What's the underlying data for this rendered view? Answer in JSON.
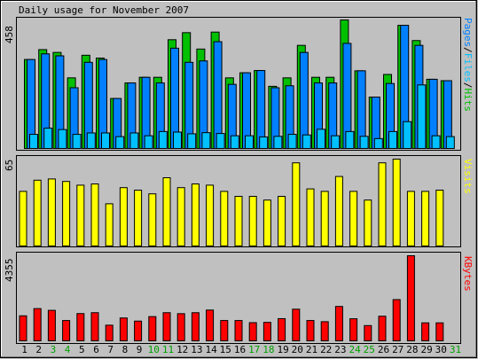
{
  "chart_data": [
    {
      "type": "bar",
      "title": "Daily usage for November 2007",
      "panel": "pages-files-hits",
      "ymax_label": "458",
      "legend": [
        {
          "label": "Pages",
          "color": "#0080ff"
        },
        {
          "label": "Files",
          "color": "#00c0ff"
        },
        {
          "label": "Hits",
          "color": "#00c000"
        }
      ],
      "legend_sep": "/",
      "categories": [
        "1",
        "2",
        "3",
        "4",
        "5",
        "6",
        "7",
        "8",
        "9",
        "10",
        "11",
        "12",
        "13",
        "14",
        "15",
        "16",
        "17",
        "18",
        "19",
        "20",
        "21",
        "22",
        "23",
        "24",
        "25",
        "26",
        "27",
        "28",
        "29",
        "30",
        "31"
      ],
      "series": [
        {
          "name": "Hits",
          "color": "#00c000",
          "values": [
            315,
            350,
            340,
            250,
            330,
            320,
            177,
            232,
            252,
            252,
            385,
            410,
            352,
            412,
            250,
            268,
            276,
            220,
            250,
            365,
            252,
            252,
            455,
            275,
            182,
            262,
            436,
            382,
            245,
            240,
            0
          ]
        },
        {
          "name": "Pages",
          "color": "#0080ff",
          "values": [
            315,
            335,
            328,
            215,
            305,
            315,
            177,
            232,
            252,
            232,
            355,
            305,
            310,
            378,
            227,
            268,
            276,
            215,
            222,
            340,
            232,
            232,
            372,
            275,
            182,
            230,
            436,
            365,
            245,
            240,
            0
          ]
        },
        {
          "name": "Files",
          "color": "#00c0ff",
          "values": [
            50,
            72,
            67,
            50,
            55,
            55,
            42,
            55,
            45,
            60,
            58,
            52,
            56,
            53,
            45,
            45,
            41,
            43,
            50,
            48,
            68,
            45,
            60,
            43,
            35,
            60,
            95,
            225,
            45,
            42,
            0
          ]
        }
      ]
    },
    {
      "type": "bar",
      "panel": "visits",
      "ymax_label": "65",
      "legend": [
        {
          "label": "Visits",
          "color": "#ffff00"
        }
      ],
      "categories": [
        "1",
        "2",
        "3",
        "4",
        "5",
        "6",
        "7",
        "8",
        "9",
        "10",
        "11",
        "12",
        "13",
        "14",
        "15",
        "16",
        "17",
        "18",
        "19",
        "20",
        "21",
        "22",
        "23",
        "24",
        "25",
        "26",
        "27",
        "28",
        "29",
        "30",
        "31"
      ],
      "series": [
        {
          "name": "Visits",
          "color": "#ffff00",
          "values": [
            44,
            53,
            54,
            52,
            49,
            50,
            34,
            47,
            45,
            42,
            55,
            47,
            50,
            49,
            44,
            40,
            40,
            37,
            40,
            67,
            46,
            44,
            56,
            44,
            37,
            67,
            70,
            44,
            44,
            45,
            0
          ]
        }
      ]
    },
    {
      "type": "bar",
      "panel": "kbytes",
      "ymax_label": "4355",
      "legend": [
        {
          "label": "KBytes",
          "color": "#ff0000"
        }
      ],
      "categories": [
        "1",
        "2",
        "3",
        "4",
        "5",
        "6",
        "7",
        "8",
        "9",
        "10",
        "11",
        "12",
        "13",
        "14",
        "15",
        "16",
        "17",
        "18",
        "19",
        "20",
        "21",
        "22",
        "23",
        "24",
        "25",
        "26",
        "27",
        "28",
        "29",
        "30",
        "31"
      ],
      "series": [
        {
          "name": "KBytes",
          "color": "#ff0000",
          "values": [
            1280,
            1650,
            1560,
            1040,
            1395,
            1440,
            800,
            1170,
            1010,
            1240,
            1440,
            1390,
            1440,
            1575,
            1040,
            1040,
            930,
            945,
            1135,
            1620,
            1040,
            980,
            1760,
            1130,
            780,
            1260,
            2110,
            4355,
            920,
            920,
            0
          ]
        }
      ]
    }
  ],
  "x_axis": {
    "labels": [
      "1",
      "2",
      "3",
      "4",
      "5",
      "6",
      "7",
      "8",
      "9",
      "10",
      "11",
      "12",
      "13",
      "14",
      "15",
      "16",
      "17",
      "18",
      "19",
      "20",
      "21",
      "22",
      "23",
      "24",
      "25",
      "26",
      "27",
      "28",
      "29",
      "30",
      "31"
    ],
    "weekend_days": [
      "3",
      "4",
      "10",
      "11",
      "17",
      "18",
      "24",
      "25",
      "31"
    ],
    "weekday_color": "#000000",
    "weekend_color": "#00a000"
  }
}
